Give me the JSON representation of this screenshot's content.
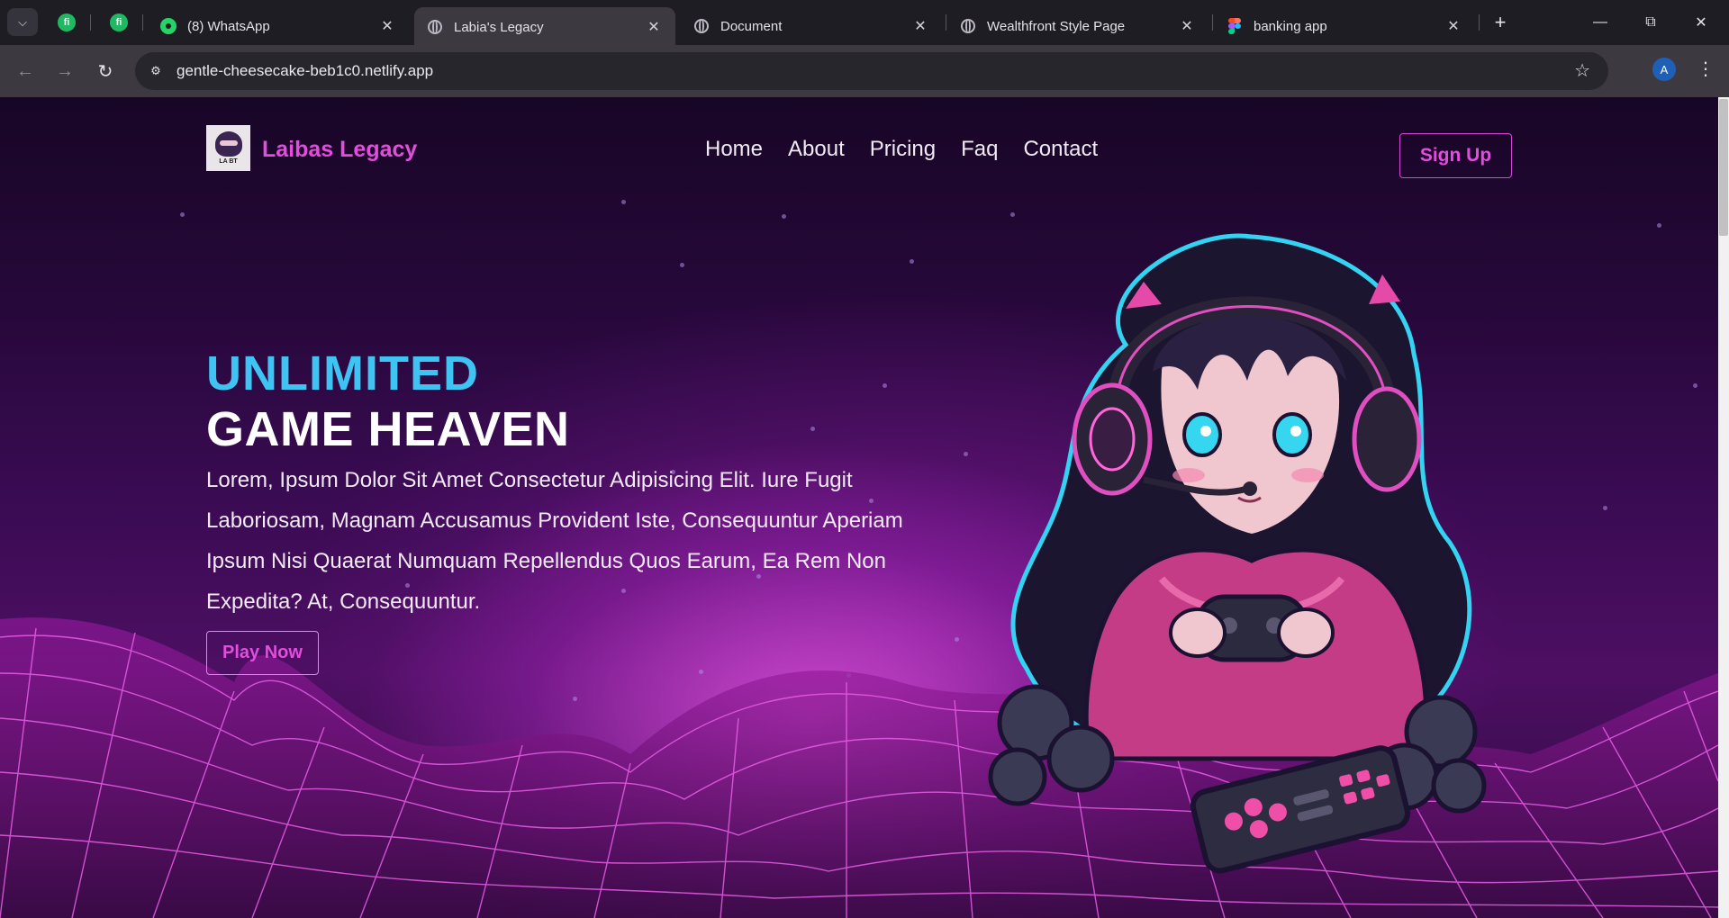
{
  "browser": {
    "tabs": [
      {
        "title": "(8) WhatsApp",
        "favicon": "whatsapp-icon"
      },
      {
        "title": "Labia's Legacy",
        "favicon": "globe-icon",
        "active": true
      },
      {
        "title": "Document",
        "favicon": "globe-icon"
      },
      {
        "title": "Wealthfront Style Page",
        "favicon": "globe-icon"
      },
      {
        "title": "banking app",
        "favicon": "figma-icon"
      }
    ],
    "pinned_tab_label": "fi",
    "close_glyph": "✕",
    "new_tab_glyph": "+",
    "url": "gentle-cheesecake-beb1c0.netlify.app",
    "profile_initial": "A"
  },
  "site": {
    "brand": "Laibas Legacy",
    "logo_text": "LA BT",
    "nav": [
      "Home",
      "About",
      "Pricing",
      "Faq",
      "Contact"
    ],
    "signup_label": "Sign Up"
  },
  "hero": {
    "headline_line1": "UNLIMITED",
    "headline_line2": "GAME HEAVEN",
    "paragraph": "Lorem, Ipsum Dolor Sit Amet Consectetur Adipisicing Elit. Iure Fugit Laboriosam, Magnam Accusamus Provident Iste, Consequuntur Aperiam Ipsum Nisi Quaerat Numquam Repellendus Quos Earum, Ea Rem Non Expedita? At, Consequuntur.",
    "cta_label": "Play Now"
  },
  "colors": {
    "brand_pink": "#e24ddc",
    "headline_cyan": "#3ec3f2",
    "background_purple": "#3b0b54"
  }
}
